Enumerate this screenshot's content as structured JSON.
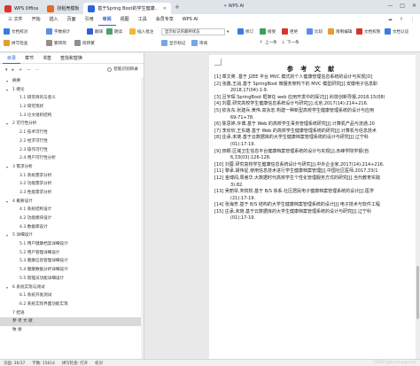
{
  "titlebar": {
    "tabs": [
      {
        "label": "WPS Office",
        "color": "#d9342b"
      },
      {
        "label": "找稻壳模板",
        "color": "#e86a1f"
      },
      {
        "label": "基于Spring Boot的学生健康..",
        "color": "#2e63d6"
      }
    ],
    "ai_label": "WPS AI",
    "controls": [
      "—",
      "□",
      "✕"
    ]
  },
  "menubar": {
    "file": "三 文件",
    "items": [
      "开始",
      "插入",
      "页面",
      "引用",
      "审阅",
      "视图",
      "工具",
      "会员专享"
    ],
    "active": "审阅",
    "ai": "WPS AI"
  },
  "ribbon": {
    "row1": [
      "文档校对",
      "拼写检查",
      "字数统计",
      "翻译",
      "朗读",
      "插入批注",
      "显示标记的最终状态",
      "修订",
      "接受",
      "拒绝",
      "上一条",
      "下一条",
      "比较",
      "限制编辑",
      "文档权限",
      "文档认证"
    ],
    "row2": [
      "繁转简",
      "简转繁",
      "显示标记",
      "审阅"
    ],
    "view_select": "显示标记的最终状态"
  },
  "nav": {
    "tabs": [
      "目录",
      "章节",
      "书签",
      "查找和替换"
    ],
    "active_tab": "目录",
    "smart_button": "智能识别目录",
    "items": [
      {
        "label": "摘要",
        "level": 1,
        "arrow": "▾"
      },
      {
        "label": "1 绪论",
        "level": 1,
        "arrow": "▾"
      },
      {
        "label": "1.1 研究目的与意义",
        "level": 2
      },
      {
        "label": "1.2 研究现状",
        "level": 2
      },
      {
        "label": "1.3 论文组织结构",
        "level": 2
      },
      {
        "label": "2 可行性分析",
        "level": 1,
        "arrow": "▾"
      },
      {
        "label": "2.1 技术可行性",
        "level": 2
      },
      {
        "label": "2.2 经济可行性",
        "level": 2
      },
      {
        "label": "2.3 操作可行性",
        "level": 2
      },
      {
        "label": "2.4 用户可行性分析",
        "level": 2
      },
      {
        "label": "3 需求分析",
        "level": 1,
        "arrow": "▾"
      },
      {
        "label": "3.1 系统需求分析",
        "level": 2
      },
      {
        "label": "3.2 功能需求分析",
        "level": 2
      },
      {
        "label": "3.3 性能需求分析",
        "level": 2
      },
      {
        "label": "4 概要设计",
        "level": 1,
        "arrow": "▾"
      },
      {
        "label": "4.1 系统结构设计",
        "level": 2
      },
      {
        "label": "4.2 功能模块设计",
        "level": 2
      },
      {
        "label": "4.3 数据库设计",
        "level": 2
      },
      {
        "label": "5 详细设计",
        "level": 1,
        "arrow": "▾"
      },
      {
        "label": "5.1 用户健康档案详细设计",
        "level": 2
      },
      {
        "label": "5.2 用户管理详细设计",
        "level": 2
      },
      {
        "label": "5.3 健康信息管理详细设计",
        "level": 2
      },
      {
        "label": "5.4 健康数据分析详细设计",
        "level": 2
      },
      {
        "label": "5.5 管理员功能详细设计",
        "level": 2
      },
      {
        "label": "6 系统实现与测试",
        "level": 1,
        "arrow": "▾"
      },
      {
        "label": "6.1 系统开发测试",
        "level": 2
      },
      {
        "label": "6.2 系统实际界面功能实现",
        "level": 2
      },
      {
        "label": "7 结语",
        "level": 1,
        "arrow": ""
      },
      {
        "label": "参 考 文 献",
        "level": 1,
        "arrow": "",
        "selected": true
      },
      {
        "label": "致 谢",
        "level": 1,
        "arrow": ""
      }
    ]
  },
  "document": {
    "heading": "参 考 文 献",
    "refs": [
      {
        "text": "[1] 章文英. 基于 J2EE 平台 MVC 模式的个人健康管理信息系统的设计与实现[D]",
        "cont": false
      },
      {
        "text": "[2] 张鑫,王战.基于 SpringBoot 微服务架构下的 MVC 模型研究[J].安徽电子信息职",
        "cont": false
      },
      {
        "text": "2018,17(04):1-9.",
        "cont": true
      },
      {
        "text": "[3] 吕宇琛.SpringBoot 框架在 web 应用开发中的探讨[J].科技创新导报,2018,15(08)",
        "cont": false
      },
      {
        "text": "[4] 刘蓉.研究高校学生健康信息系统设计与研究[J].北京,2017(14):214+216.",
        "cont": false
      },
      {
        "text": "[5] 钦永东.张建兵.黄伟.高永宏.构建一种新型高校学生健康管理系统的设计与应用",
        "cont": false
      },
      {
        "text": "69-71+78.",
        "cont": true
      },
      {
        "text": "[6] 陈思婷,许博.基于 Web 的高校学生事务管理系统研究[J].计算机产品与流通,20",
        "cont": false
      },
      {
        "text": "[7] 李欣欣,王东雄.基于 Web 的高校学生健康管理系统的研究[J].计算机与信息技术",
        "cont": false
      },
      {
        "text": "[8] 庄承,未琏.基于云数据库的大学生健康档案管理系统的设计与研究[J].辽宁科",
        "cont": false
      },
      {
        "text": "(01):17-19.",
        "cont": true
      },
      {
        "text": "[9] 田颖.区域卫生信息平台健康档案管理系统的设计与实现[J].赤峰学院学报(自",
        "cont": false
      },
      {
        "text": "6,33(03):126-128.",
        "cont": true
      },
      {
        "text": "[10] 刘蓉.研究高校学生健康信息系统设计与研究[J].中外企业家,2017(14):214+216.",
        "cont": false
      },
      {
        "text": "[11] 黎承,胡伟星.使用信息技术进行学生健康档案管理[J].中国社区医师,2017,33(1",
        "cont": false
      },
      {
        "text": "[12] 金博闻,周睿华.大数据时代高校学生个性化管理服务方式的研究[J].当代教育实践",
        "cont": false
      },
      {
        "text": "3):82.",
        "cont": true
      },
      {
        "text": "[13] 吴丽琴,宋姣姣.基于 B/S 体系.社区居民电子健康档案管理系统的设计[J].医学",
        "cont": false
      },
      {
        "text": "(21):17-19.",
        "cont": true
      },
      {
        "text": "[14] 张海芳.基于 B/S 结构的大学生健康档案管理系统的设计[J].电子技术与软件工程",
        "cont": false
      },
      {
        "text": "[15] 庄承,未琏.基于云数据库的大学生健康档案管理系统的设计与研究[J].辽宁科",
        "cont": false
      },
      {
        "text": "(01):17-19.",
        "cont": true
      }
    ]
  },
  "status": {
    "page": "页面: 36/37",
    "words": "字数: 15614",
    "spell": "拼写检查: 打开",
    "proof": "校对",
    "watermark": "CSDN @biyezuopinvip"
  },
  "colors": {
    "accent": "#2e63d6",
    "wps_red": "#d9342b"
  }
}
